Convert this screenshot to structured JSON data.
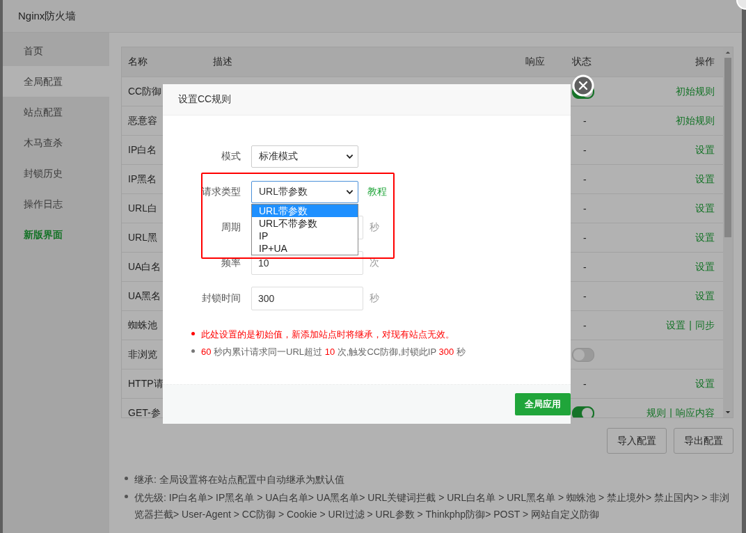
{
  "window": {
    "title": "Nginx防火墙"
  },
  "sidebar": {
    "items": [
      {
        "label": "首页",
        "selected": false,
        "kind": "nav"
      },
      {
        "label": "全局配置",
        "selected": true,
        "kind": "nav"
      },
      {
        "label": "站点配置",
        "selected": false,
        "kind": "nav"
      },
      {
        "label": "木马查杀",
        "selected": false,
        "kind": "nav"
      },
      {
        "label": "封锁历史",
        "selected": false,
        "kind": "nav"
      },
      {
        "label": "操作日志",
        "selected": false,
        "kind": "nav"
      },
      {
        "label": "新版界面",
        "selected": false,
        "kind": "link"
      }
    ]
  },
  "table": {
    "columns": [
      "名称",
      "描述",
      "响应",
      "状态",
      "操作"
    ],
    "action_separator": "|",
    "rows": [
      {
        "name": "CC防御",
        "status": {
          "kind": "switch",
          "on": true
        },
        "actions": [
          "初始规则"
        ]
      },
      {
        "name": "恶意容",
        "status": {
          "kind": "text",
          "text": "-"
        },
        "actions": [
          "初始规则"
        ]
      },
      {
        "name": "IP白名",
        "status": {
          "kind": "text",
          "text": "-"
        },
        "actions": [
          "设置"
        ]
      },
      {
        "name": "IP黑名",
        "status": {
          "kind": "text",
          "text": "-"
        },
        "actions": [
          "设置"
        ]
      },
      {
        "name": "URL白",
        "status": {
          "kind": "text",
          "text": "-"
        },
        "actions": [
          "设置"
        ]
      },
      {
        "name": "URL黑",
        "status": {
          "kind": "text",
          "text": "-"
        },
        "actions": [
          "设置"
        ]
      },
      {
        "name": "UA白名",
        "status": {
          "kind": "text",
          "text": "-"
        },
        "actions": [
          "设置"
        ]
      },
      {
        "name": "UA黑名",
        "status": {
          "kind": "text",
          "text": "-"
        },
        "actions": [
          "设置"
        ]
      },
      {
        "name": "蜘蛛池",
        "status": {
          "kind": "text",
          "text": "-"
        },
        "actions": [
          "设置",
          "同步"
        ]
      },
      {
        "name": "非浏览",
        "status": {
          "kind": "switch",
          "on": false
        },
        "actions": []
      },
      {
        "name": "HTTP请",
        "status": {
          "kind": "text",
          "text": "-"
        },
        "actions": [
          "设置"
        ]
      },
      {
        "name": "GET-参",
        "status": {
          "kind": "switch",
          "on": true
        },
        "actions": [
          "规则",
          "响应内容"
        ]
      }
    ]
  },
  "buttons": [
    "导入配置",
    "导出配置"
  ],
  "notes": [
    "继承: 全局设置将在站点配置中自动继承为默认值",
    "优先级: IP白名单> IP黑名单 > UA白名单> UA黑名单> URL关键词拦截 > URL白名单 > URL黑名单 > 蜘蛛池 > 禁止境外> 禁止国内> > 非浏览器拦截> User-Agent > CC防御 > Cookie > URI过滤 > URL参数 > Thinkphp防御> POST > 网站自定义防御"
  ],
  "dialog": {
    "title": "设置CC规则",
    "fields": [
      {
        "label": "模式",
        "kind": "select",
        "value": "标准模式",
        "open": false
      },
      {
        "label": "请求类型",
        "kind": "select",
        "value": "URL带参数",
        "open": true,
        "link": "教程",
        "options": [
          {
            "label": "URL带参数",
            "selected": true
          },
          {
            "label": "URL不带参数",
            "selected": false
          },
          {
            "label": "IP",
            "selected": false
          },
          {
            "label": "IP+UA",
            "selected": false
          }
        ]
      },
      {
        "label": "周期",
        "kind": "input",
        "unit": "秒"
      },
      {
        "label": "频率",
        "kind": "input",
        "value": "10",
        "unit": "次"
      },
      {
        "label": "封锁时间",
        "kind": "input",
        "value": "300",
        "unit": "秒"
      }
    ],
    "notes": [
      {
        "kind": "warning",
        "text": "此处设置的是初始值，新添加站点时将继承，对现有站点无效。"
      },
      {
        "kind": "info",
        "parts": [
          {
            "text": "60",
            "highlight": true
          },
          {
            "text": " 秒内累计请求同一URL超过 ",
            "highlight": false
          },
          {
            "text": "10",
            "highlight": true
          },
          {
            "text": " 次,触发CC防御,封锁此IP ",
            "highlight": false
          },
          {
            "text": "300",
            "highlight": true
          },
          {
            "text": " 秒",
            "highlight": false
          }
        ]
      }
    ],
    "button": "全局应用"
  }
}
